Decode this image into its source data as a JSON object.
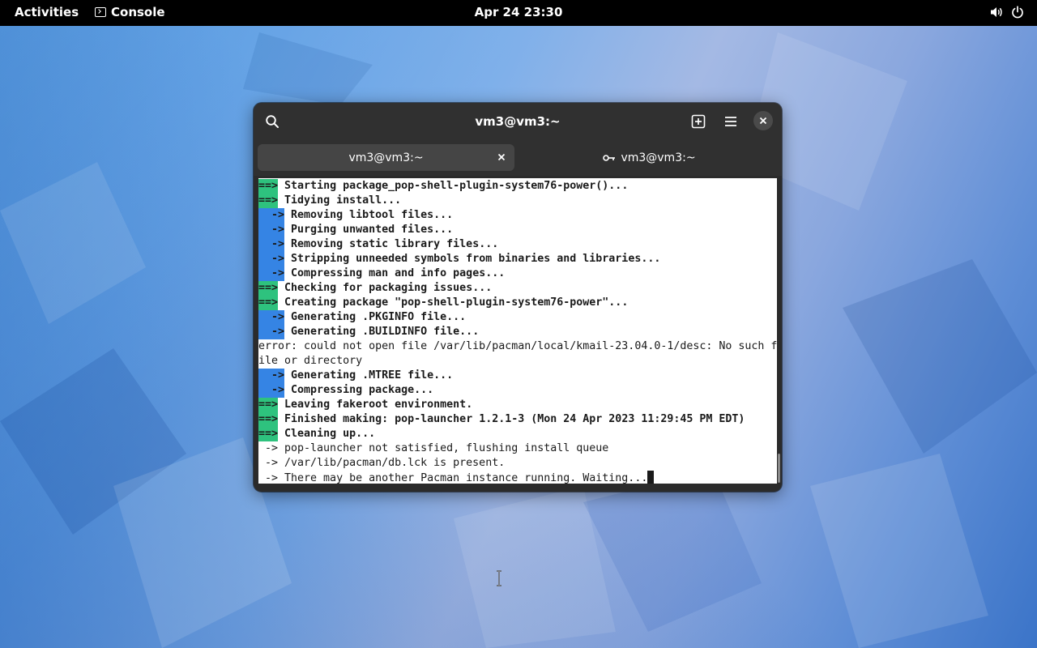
{
  "topbar": {
    "activities": "Activities",
    "app_name": "Console",
    "clock": "Apr 24  23:30",
    "icons": [
      "volume-icon",
      "power-icon"
    ]
  },
  "window": {
    "title": "vm3@vm3:~",
    "icons": [
      "search-icon",
      "new-tab-icon",
      "menu-icon",
      "close-icon"
    ],
    "tabs": [
      {
        "label": "vm3@vm3:~",
        "active": true
      },
      {
        "label": "vm3@vm3:~",
        "active": false,
        "icon": "key-icon"
      }
    ]
  },
  "terminal": {
    "lines": [
      {
        "marker": "==>",
        "kind": "green",
        "text": " Starting package_pop-shell-plugin-system76-power()..."
      },
      {
        "marker": "==>",
        "kind": "green",
        "text": " Tidying install..."
      },
      {
        "marker": "  ->",
        "kind": "blue",
        "text": " Removing libtool files..."
      },
      {
        "marker": "  ->",
        "kind": "blue",
        "text": " Purging unwanted files..."
      },
      {
        "marker": "  ->",
        "kind": "blue",
        "text": " Removing static library files..."
      },
      {
        "marker": "  ->",
        "kind": "blue",
        "text": " Stripping unneeded symbols from binaries and libraries..."
      },
      {
        "marker": "  ->",
        "kind": "blue",
        "text": " Compressing man and info pages..."
      },
      {
        "marker": "==>",
        "kind": "green",
        "text": " Checking for packaging issues..."
      },
      {
        "marker": "==>",
        "kind": "green",
        "text": " Creating package \"pop-shell-plugin-system76-power\"..."
      },
      {
        "marker": "  ->",
        "kind": "blue",
        "text": " Generating .PKGINFO file..."
      },
      {
        "marker": "  ->",
        "kind": "blue",
        "text": " Generating .BUILDINFO file..."
      },
      {
        "marker": "",
        "kind": "plain",
        "text": "error: could not open file /var/lib/pacman/local/kmail-23.04.0-1/desc: No such f"
      },
      {
        "marker": "",
        "kind": "plain",
        "text": "ile or directory"
      },
      {
        "marker": "  ->",
        "kind": "blue",
        "text": " Generating .MTREE file..."
      },
      {
        "marker": "  ->",
        "kind": "blue",
        "text": " Compressing package..."
      },
      {
        "marker": "==>",
        "kind": "green",
        "text": " Leaving fakeroot environment."
      },
      {
        "marker": "==>",
        "kind": "green",
        "text": " Finished making: pop-launcher 1.2.1-3 (Mon 24 Apr 2023 11:29:45 PM EDT)"
      },
      {
        "marker": "==>",
        "kind": "green",
        "text": " Cleaning up..."
      },
      {
        "marker": "",
        "kind": "plain",
        "text": " -> pop-launcher not satisfied, flushing install queue"
      },
      {
        "marker": "",
        "kind": "plain",
        "text": " -> /var/lib/pacman/db.lck is present."
      },
      {
        "marker": "",
        "kind": "plain",
        "text": " -> There may be another Pacman instance running. Waiting..."
      }
    ]
  },
  "colors": {
    "green_marker": "#2ec27e",
    "blue_marker": "#3584e4",
    "topbar": "#000000",
    "headerbar": "#303030"
  }
}
